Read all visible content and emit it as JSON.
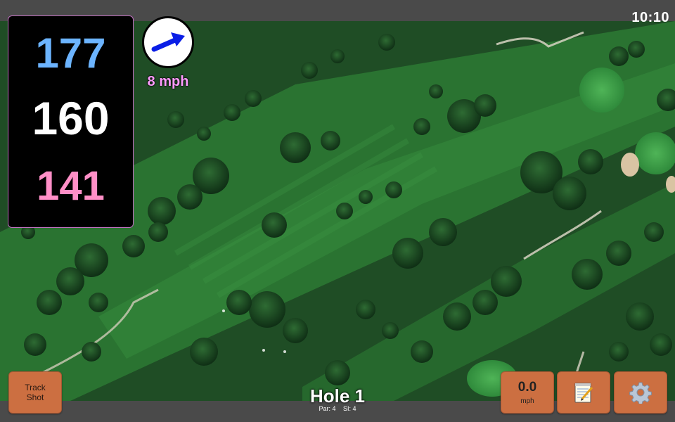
{
  "status_bar": {
    "time": "10:10"
  },
  "distances": {
    "back": {
      "value": "177",
      "color": "#6cb4ff"
    },
    "middle": {
      "value": "160",
      "color": "#ffffff"
    },
    "front": {
      "value": "141",
      "color": "#ff8fc7"
    }
  },
  "wind": {
    "speed_label": "8 mph",
    "arrow_color": "#0a1ee6",
    "icon": "wind-direction-arrow-icon"
  },
  "buttons": {
    "track_shot": {
      "line1": "Track",
      "line2": "Shot"
    },
    "speed": {
      "value": "0.0",
      "unit": "mph"
    },
    "notes": {
      "icon": "notepad-icon"
    },
    "settings": {
      "icon": "gear-icon"
    }
  },
  "hole": {
    "title": "Hole 1",
    "par": "Par: 4",
    "si": "SI: 4"
  }
}
